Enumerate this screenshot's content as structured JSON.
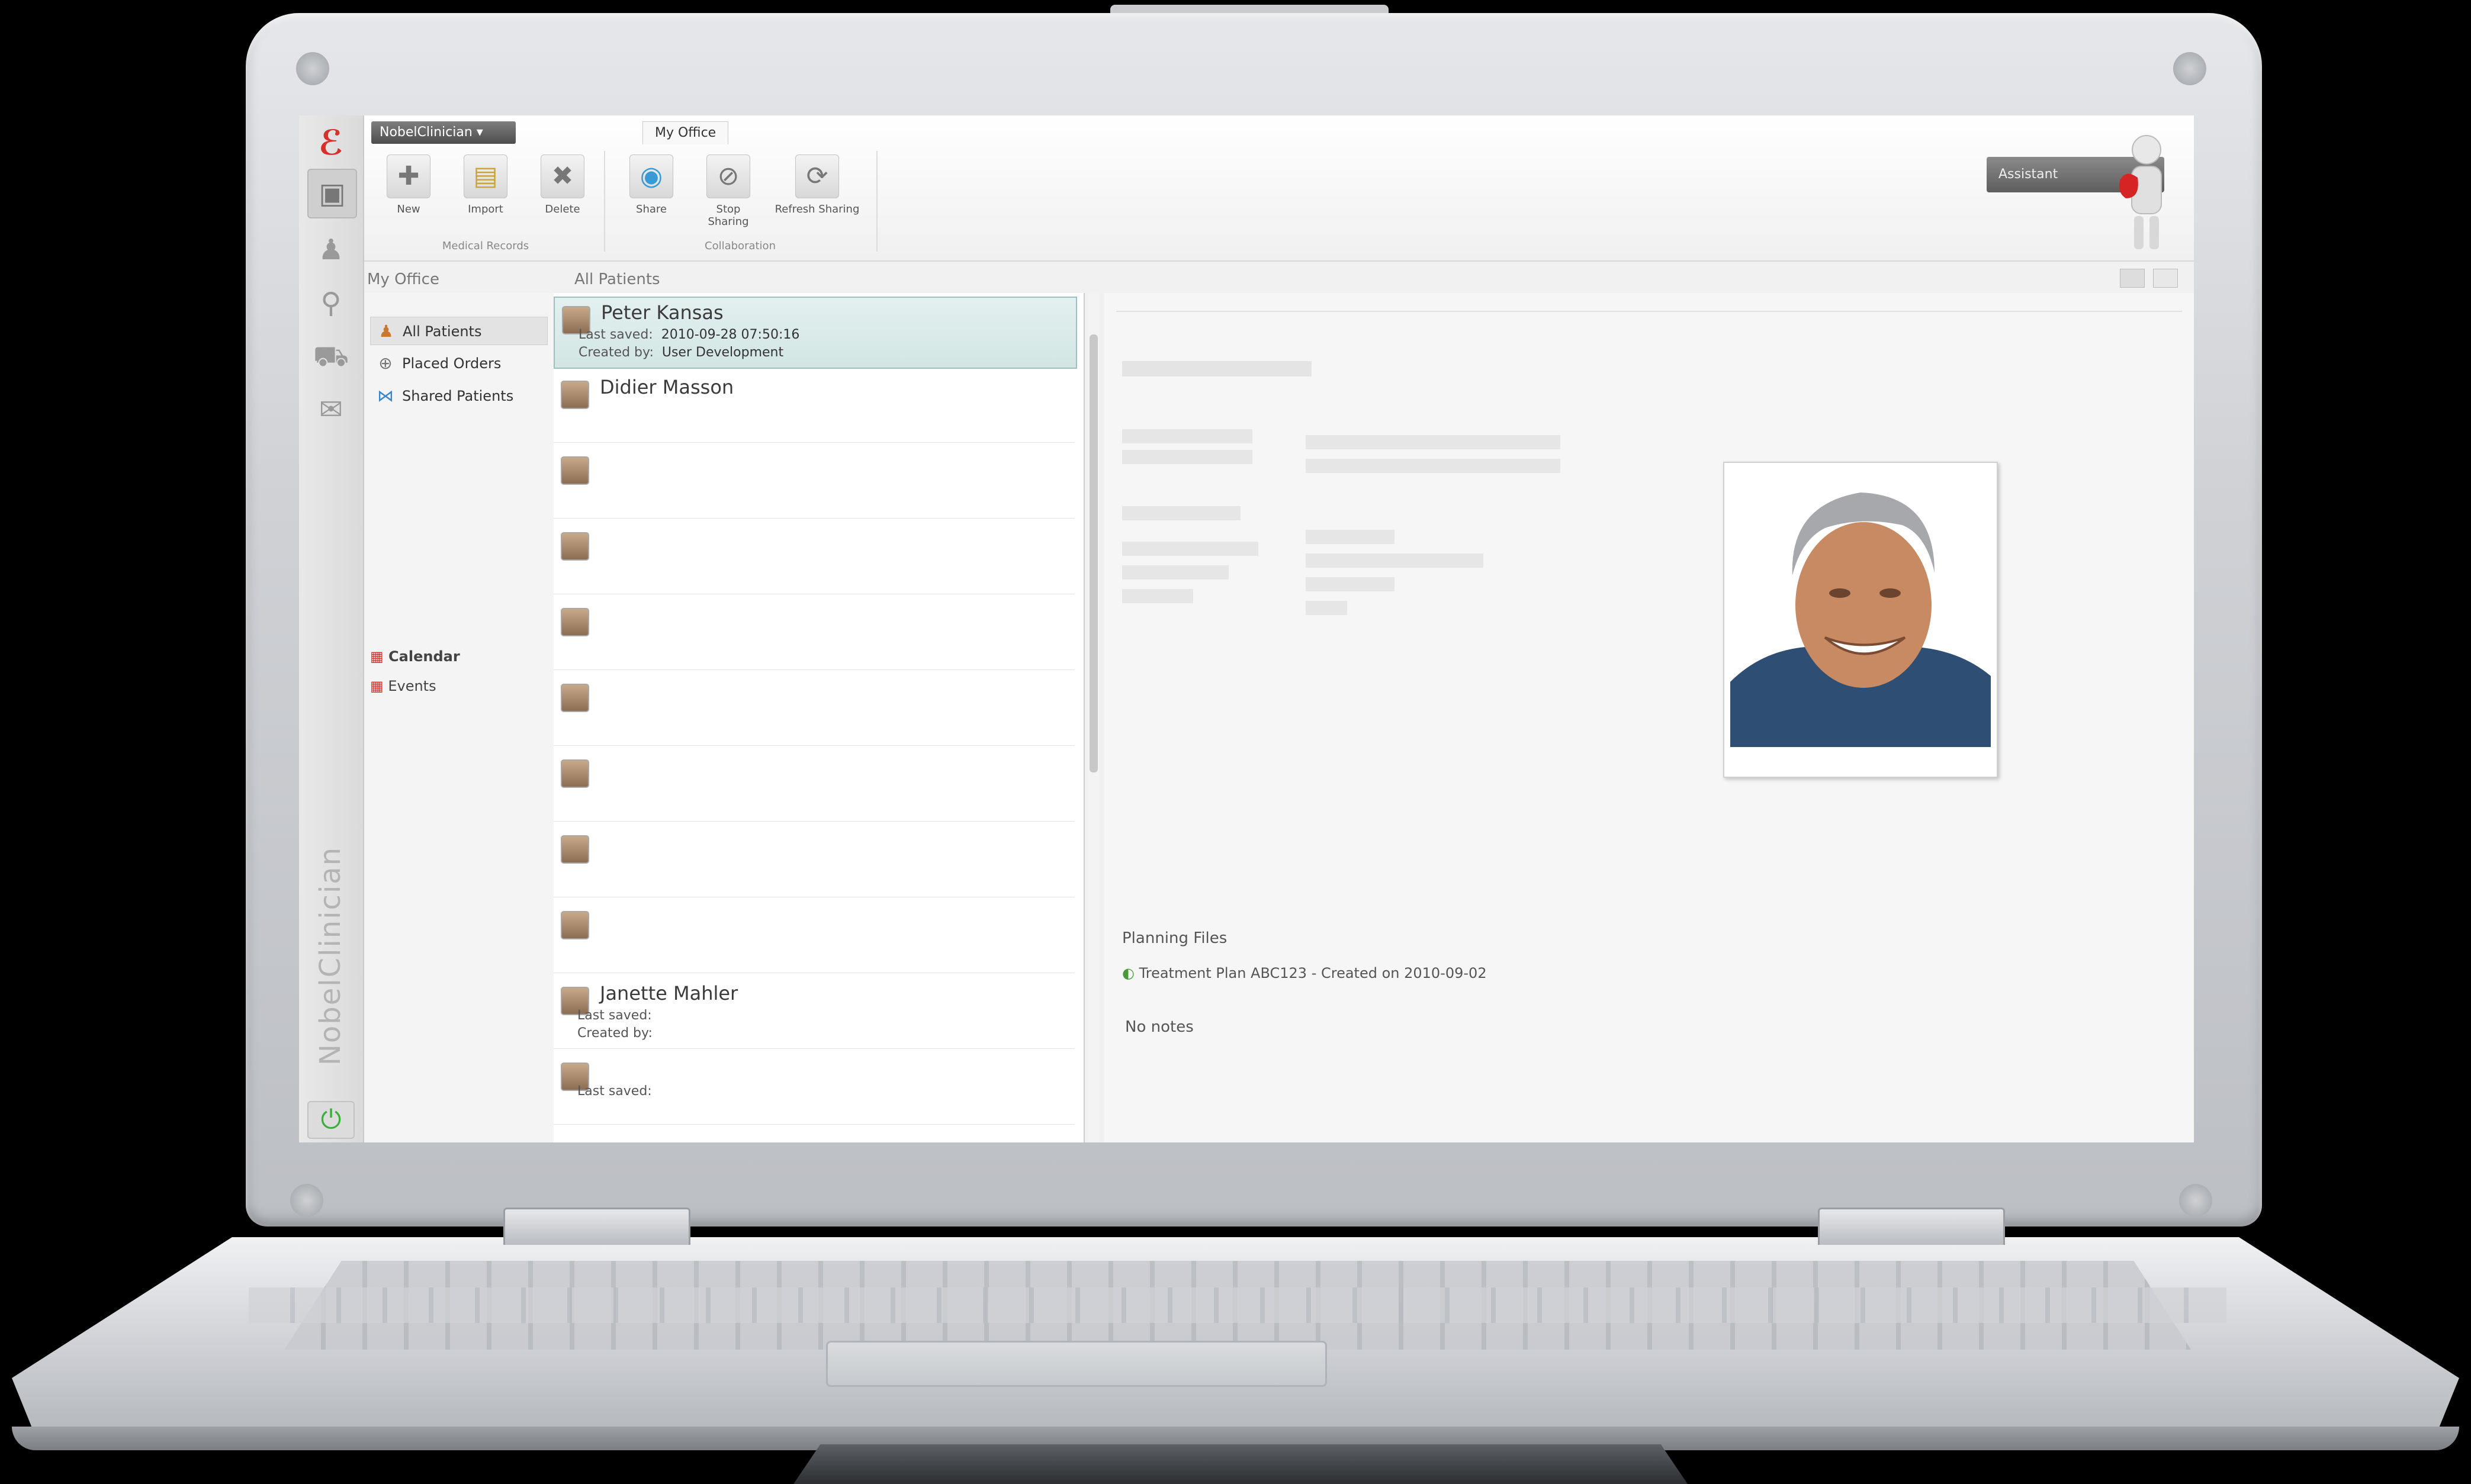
{
  "app": {
    "brand": "NobelClinician",
    "menu_label": "NobelClinician ▾",
    "ribbon_tabs": [
      "",
      "My Office"
    ],
    "ribbon_groups": [
      {
        "label": "Medical Records",
        "buttons": [
          "New",
          "Import",
          "Delete"
        ]
      },
      {
        "label": "Collaboration",
        "buttons": [
          "Share",
          "Stop Sharing",
          "Refresh Sharing"
        ]
      }
    ],
    "assistant_label": "Assistant"
  },
  "panes": {
    "office_title": "My Office",
    "list_title": "All Patients"
  },
  "office_nav": {
    "items": [
      {
        "label": "All Patients",
        "icon": "patient-icon",
        "selected": true
      },
      {
        "label": "Placed Orders",
        "icon": "orders-icon",
        "selected": false
      },
      {
        "label": "Shared Patients",
        "icon": "share-icon",
        "selected": false
      }
    ],
    "sections": [
      "Calendar",
      "Events"
    ]
  },
  "patients": [
    {
      "name": "Peter Kansas",
      "last_saved_label": "Last saved:",
      "last_saved": "2010-09-28 07:50:16",
      "created_by_label": "Created by:",
      "created_by": "User Development",
      "selected": true
    },
    {
      "name": "Didier Masson",
      "last_saved_label": "",
      "last_saved": "",
      "created_by_label": "",
      "created_by": "",
      "selected": false
    },
    {
      "name": "",
      "last_saved_label": "",
      "last_saved": "",
      "created_by_label": "",
      "created_by": "",
      "selected": false
    },
    {
      "name": "",
      "last_saved_label": "",
      "last_saved": "",
      "created_by_label": "",
      "created_by": "",
      "selected": false
    },
    {
      "name": "",
      "last_saved_label": "",
      "last_saved": "",
      "created_by_label": "",
      "created_by": "",
      "selected": false
    },
    {
      "name": "",
      "last_saved_label": "",
      "last_saved": "",
      "created_by_label": "",
      "created_by": "",
      "selected": false
    },
    {
      "name": "",
      "last_saved_label": "",
      "last_saved": "",
      "created_by_label": "",
      "created_by": "",
      "selected": false
    },
    {
      "name": "",
      "last_saved_label": "",
      "last_saved": "",
      "created_by_label": "",
      "created_by": "",
      "selected": false
    },
    {
      "name": "",
      "last_saved_label": "",
      "last_saved": "",
      "created_by_label": "",
      "created_by": "",
      "selected": false
    },
    {
      "name": "Janette Mahler",
      "last_saved_label": "Last saved:",
      "last_saved": "",
      "created_by_label": "Created by:",
      "created_by": "",
      "selected": false
    },
    {
      "name": "",
      "last_saved_label": "Last saved:",
      "last_saved": "",
      "created_by_label": "",
      "created_by": "",
      "selected": false
    }
  ],
  "detail": {
    "planning_title": "Planning Files",
    "plan_item": "Treatment Plan ABC123 - Created on 2010-09-02",
    "notes_title": "No notes"
  }
}
